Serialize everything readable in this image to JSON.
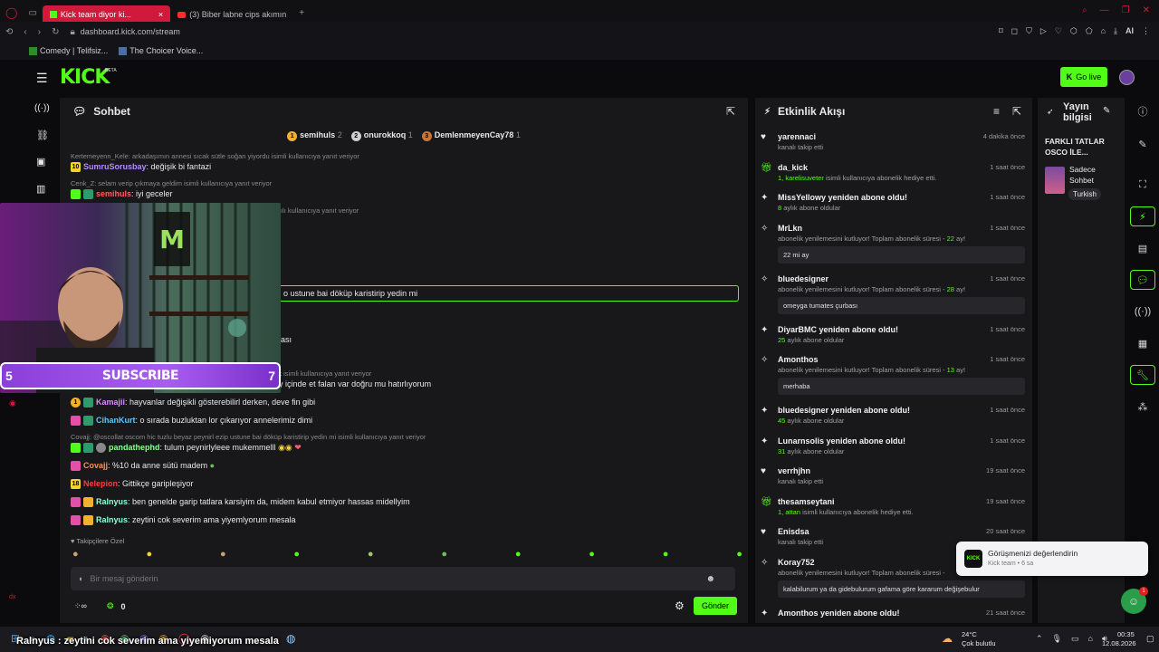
{
  "browser": {
    "tabs": [
      {
        "label": "Kick team diyor ki...",
        "active": true
      },
      {
        "label": "(3) Biber labne cips akımın",
        "active": false
      }
    ],
    "url": "dashboard.kick.com/stream",
    "bookmarks": [
      "Comedy | Telifsiz...",
      "The Choicer Voice..."
    ],
    "ai_label": "AI"
  },
  "app": {
    "logo": "KICK",
    "beta": "BETA",
    "go_live": "Go live"
  },
  "chat": {
    "title": "Sohbet",
    "pinned": [
      {
        "rank": "1",
        "name": "semihuls",
        "count": "2"
      },
      {
        "rank": "2",
        "name": "onurokkoq",
        "count": "1"
      },
      {
        "rank": "3",
        "name": "DemlenmeyenCay78",
        "count": "1"
      }
    ],
    "lines": [
      {
        "reply": "Kertemeyenn_Kele: arkadaşımın annesi sıcak sütle soğan yiyordu isimli kullanıcıya yanıt veriyor",
        "name": "",
        "text": ""
      },
      {
        "reply": "",
        "name": "SumruSorusbay",
        "text": ": değişik bi fantazi"
      },
      {
        "reply": "Cenk_Z: selam verip çıkmaya geldim isimli kullanıcıya yanıt veriyor",
        "name": "",
        "text": ""
      },
      {
        "reply": "",
        "name": "semihuls",
        "text": ": iyi geceler"
      },
      {
        "reply": "ılı kullanıcıya yanıt veriyor",
        "name": "",
        "text": ""
      },
      {
        "reply": "",
        "name": "",
        "text": "o ustune bai döküp karistirip yedin mi"
      },
      {
        "reply": "",
        "name": "",
        "text": "ası"
      },
      {
        "reply": "ayı var o baya değişik olarak isimli kullanıcıya yanıt veriyor",
        "name": "",
        "text": ""
      },
      {
        "reply": "",
        "name": "",
        "text": "onu kış çayı dedikleri birşey içinde et falan var doğru mu hatırlıyorum"
      },
      {
        "reply": "",
        "name": "Kamajii",
        "text": ": hayvanlar değişikli gösterebilirl derken, deve fin gibi"
      },
      {
        "reply": "",
        "name": "CihanKurt",
        "text": ": o sırada buzluktan lor çıkarıyor annelerimiz dimi"
      },
      {
        "reply": "Covajj: @oscollat oscom hic tuzlu beyaz peynirl ezip ustune bai döküp karistirip yedin mi isimli kullanıcıya yanıt veriyor",
        "name": "",
        "text": ""
      },
      {
        "reply": "",
        "name": "pandathephd",
        "text": ": tulum peynirlyleee mukemmelll"
      },
      {
        "reply": "",
        "name": "Covajj",
        "text": ": %10 da anne sütü madem"
      },
      {
        "reply": "",
        "name": "Nelepion",
        "text": ": Gittikçe garipleşiyor"
      },
      {
        "reply": "",
        "name": "Ralnyus",
        "text": ": ben genelde garip tatlara karsiyim da, midem kabul etmiyor hassas midellyim"
      },
      {
        "reply": "",
        "name": "Ralnyus",
        "text": ": zeytini cok severim ama yiyemlyorum mesala"
      }
    ],
    "emote_label": "Takipçilere Özel",
    "input_placeholder": "Bir mesaj gönderin",
    "viewer_count": "0",
    "send_label": "Gönder"
  },
  "overlay": {
    "subscribe": "SUBSCRIBE",
    "left_num": "5",
    "right_num": "7",
    "ticker": "Ralnyus : zeytini cok severim ama yiyemiyorum mesala"
  },
  "feed": {
    "title": "Etkinlik Akışı",
    "items": [
      {
        "title": "yarennaci",
        "sub": "kanalı takip etti",
        "time": "4 dakika önce",
        "icon": "heart",
        "msg": ""
      },
      {
        "title": "da_kick",
        "sub_green": "1, karelisuveter",
        "sub": " isimli kullanıcıya abonelik hediye etti.",
        "time": "1 saat önce",
        "icon": "gift",
        "msg": ""
      },
      {
        "title": "MissYellowy yeniden abone oldu!",
        "sub_green": "8",
        "sub": " aylık abone oldular",
        "time": "1 saat önce",
        "icon": "star",
        "msg": ""
      },
      {
        "title": "MrLkn",
        "sub": "abonelik yenilemesini kutluyor! Toplam abonelik süresi - ",
        "sub_green_tail": "22",
        "sub_tail": " ay!",
        "time": "1 saat önce",
        "icon": "party",
        "msg": "22 mi ay"
      },
      {
        "title": "bluedesigner",
        "sub": "abonelik yenilemesini kutluyor! Toplam abonelik süresi - ",
        "sub_green_tail": "28",
        "sub_tail": " ay!",
        "time": "1 saat önce",
        "icon": "party",
        "msg": "omeyga tumates çurbası"
      },
      {
        "title": "DiyarBMC yeniden abone oldu!",
        "sub_green": "25",
        "sub": " aylık abone oldular",
        "time": "1 saat önce",
        "icon": "star",
        "msg": ""
      },
      {
        "title": "Amonthos",
        "sub": "abonelik yenilemesini kutluyor! Toplam abonelik süresi - ",
        "sub_green_tail": "13",
        "sub_tail": " ay!",
        "time": "1 saat önce",
        "icon": "party",
        "msg": "merhaba"
      },
      {
        "title": "bluedesigner yeniden abone oldu!",
        "sub_green": "45",
        "sub": " aylık abone oldular",
        "time": "1 saat önce",
        "icon": "star",
        "msg": ""
      },
      {
        "title": "Lunarnsolis yeniden abone oldu!",
        "sub_green": "31",
        "sub": " aylık abone oldular",
        "time": "1 saat önce",
        "icon": "star",
        "msg": ""
      },
      {
        "title": "verrhjhn",
        "sub": "kanalı takip etti",
        "time": "19 saat önce",
        "icon": "heart",
        "msg": ""
      },
      {
        "title": "thesamseytani",
        "sub_green": "1, attan",
        "sub": " isimli kullanıcıya abonelik hediye etti.",
        "time": "19 saat önce",
        "icon": "gift",
        "msg": ""
      },
      {
        "title": "Enisdsa",
        "sub": "kanalı takip etti",
        "time": "20 saat önce",
        "icon": "heart",
        "msg": ""
      },
      {
        "title": "Koray752",
        "sub": "abonelik yenilemesini kutluyor! Toplam abonelik süresi - ",
        "sub_green_tail": "",
        "sub_tail": "",
        "time": "",
        "icon": "party",
        "msg": "kalabilurum ya da gidebulurum gafama göre kararum değişebulur"
      },
      {
        "title": "Amonthos yeniden abone oldu!",
        "sub": "",
        "time": "21 saat önce",
        "icon": "star",
        "msg": ""
      }
    ]
  },
  "info": {
    "title": "Yayın bilgisi",
    "stream_title": "FARKLI TATLAR OSCO İLE...",
    "chat_mode": "Sadece Sohbet",
    "language": "Turkish"
  },
  "toast": {
    "title": "Görüşmenizi değerlendirin",
    "sub": "Kick team • 6 sa",
    "badge": "1"
  },
  "taskbar": {
    "temp": "24°C",
    "weather": "Çok bulutlu",
    "time": "00:35",
    "date": "12.08.2026"
  },
  "colors": {
    "accent": "#53fc18",
    "browser_red": "#d11a3b",
    "panel": "#18181b"
  }
}
